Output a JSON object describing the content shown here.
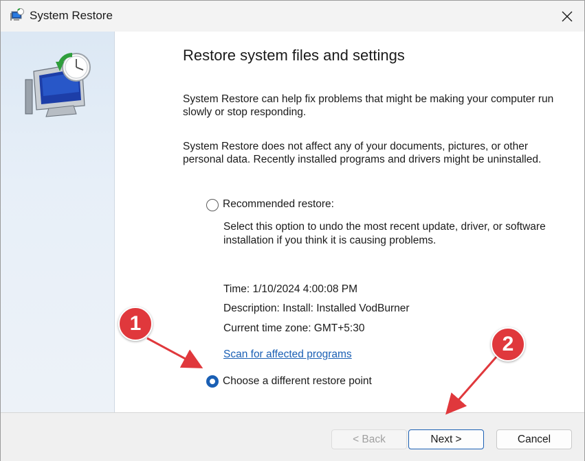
{
  "window": {
    "title": "System Restore",
    "close_icon": "close-icon"
  },
  "content": {
    "heading": "Restore system files and settings",
    "para1": "System Restore can help fix problems that might be making your computer run slowly or stop responding.",
    "para2": "System Restore does not affect any of your documents, pictures, or other personal data. Recently installed programs and drivers might be uninstalled.",
    "recommended": {
      "label": "Recommended restore:",
      "selected": false,
      "description": "Select this option to undo the most recent update, driver, or software installation if you think it is causing problems.",
      "time": "Time: 1/10/2024 4:00:08 PM",
      "description_line": "Description: Install: Installed VodBurner",
      "timezone": "Current time zone: GMT+5:30",
      "scan_link": "Scan for affected programs"
    },
    "different": {
      "label": "Choose a different restore point",
      "selected": true
    }
  },
  "footer": {
    "back_label": "< Back",
    "next_label": "Next >",
    "cancel_label": "Cancel"
  },
  "annotations": {
    "badge1": "1",
    "badge2": "2",
    "color": "#e0383c"
  },
  "colors": {
    "accent": "#1a5fb4",
    "link": "#1a5fb4"
  }
}
